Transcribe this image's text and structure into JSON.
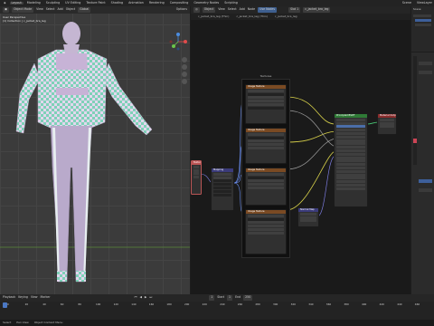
{
  "workspace_tabs": [
    "Layout",
    "Modeling",
    "Sculpting",
    "UV Editing",
    "Texture Paint",
    "Shading",
    "Animation",
    "Rendering",
    "Compositing",
    "Geometry Nodes",
    "Scripting"
  ],
  "scene": {
    "name": "Scene",
    "view_layer": "ViewLayer"
  },
  "viewport": {
    "mode": "Object Mode",
    "menus": [
      "View",
      "Select",
      "Add",
      "Object"
    ],
    "orientation": "Global",
    "options_label": "Options",
    "overlay_info": [
      "User Perspective",
      "(1) Collection | c_jacket_bra_leg"
    ]
  },
  "node_editor": {
    "mode": "Object",
    "menus": [
      "View",
      "Select",
      "Add",
      "Node"
    ],
    "use_nodes_label": "Use Nodes",
    "slot": "Slot 1",
    "material": "c_jacket_bra_leg",
    "breadcrumb": [
      "c_jacket_bra_leg (Thin)",
      "c_jacket_bra_leg (Thin)",
      "c_jacket_bra_leg"
    ],
    "frame_label": "Textures",
    "nodes": {
      "tex1": "Image Texture",
      "tex2": "Image Texture",
      "tex3": "Image Texture",
      "tex4": "Image Texture",
      "mapping": "Mapping",
      "coords": "Texture Coordinate",
      "bsdf": "Principled BSDF",
      "output": "Material Output",
      "normal": "Normal Map"
    }
  },
  "timeline": {
    "menus": [
      "Playback",
      "Keying",
      "View",
      "Marker"
    ],
    "ticks": [
      "0",
      "20",
      "40",
      "60",
      "80",
      "100",
      "120",
      "140",
      "160",
      "180",
      "200",
      "220",
      "240",
      "260",
      "280",
      "300",
      "320",
      "340",
      "360",
      "380",
      "400",
      "420",
      "440",
      "460"
    ],
    "current_frame": "1",
    "start_label": "Start",
    "start": "1",
    "end_label": "End",
    "end": "250"
  },
  "status": [
    "Select",
    "Pan View",
    "Object Context Menu"
  ],
  "colors": {
    "texture_header": "#7a4a23",
    "frame_header": "#bb5555",
    "bsdf_header": "#2f7a36",
    "output_header": "#8a2d2d",
    "vector_header": "#3b3b7a",
    "link_yellow": "#d8d14a",
    "link_gray": "#9a9a9a",
    "link_purple": "#7c7ce0",
    "link_blue": "#6a8ef0"
  }
}
